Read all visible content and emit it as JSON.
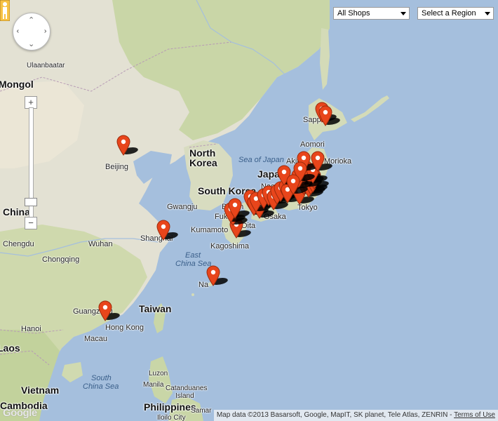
{
  "controls": {
    "zoom_in": "+",
    "zoom_out": "−",
    "shops_select": "All Shops",
    "region_select": "Select a Region"
  },
  "labels": {
    "countries": {
      "mongolia": "Mongol",
      "china": "China",
      "north_korea_1": "North",
      "north_korea_2": "Korea",
      "south_korea": "South Korea",
      "japan": "Japan",
      "taiwan": "Taiwan",
      "vietnam": "Vietnam",
      "laos": "Laos",
      "cambodia": "Cambodia",
      "philippines": "Philippines"
    },
    "seas": {
      "sea_of_japan_1": "Sea of Japan",
      "east_china_sea_1": "East",
      "east_china_sea_2": "China Sea",
      "south_china_sea_1": "South",
      "south_china_sea_2": "China Sea"
    },
    "cities": {
      "ulaanbaatar": "Ulaanbaatar",
      "beijing": "Beijing",
      "shanghai": "Shanghai",
      "wuhan": "Wuhan",
      "chengdu": "Chengdu",
      "chongqing": "Chongqing",
      "guangzhou": "Guangzhou",
      "hong_kong": "Hong Kong",
      "macau": "Macau",
      "hanoi": "Hanoi",
      "gwangju": "Gwangju",
      "busan": "Busan",
      "fukuoka": "Fuku",
      "oita": "Oita",
      "kumamoto": "Kumamoto",
      "kagoshima": "Kagoshima",
      "naha": "Na",
      "osaka": "Osaka",
      "tokyo": "Tokyo",
      "nagano": "Nagan",
      "akita": "Akita",
      "morioka": "Morioka",
      "aomori": "Aomori",
      "sapporo": "Sappo",
      "luzon": "Luzon",
      "manila": "Manila",
      "catanduanes_1": "Catanduanes",
      "catanduanes_2": "Island",
      "samar": "Samar",
      "iloilo": "Iloilo City"
    }
  },
  "attribution": {
    "text": "Map data ©2013 Basarsoft, Google, MapIT, SK planet, Tele Atlas, ZENRIN - ",
    "terms": "Terms of Use"
  },
  "logo": "Google",
  "colors": {
    "water": "#a5bfdd",
    "land": "#e6e4d9",
    "forest": "#c8d7a6",
    "pin": "#e8451b"
  }
}
